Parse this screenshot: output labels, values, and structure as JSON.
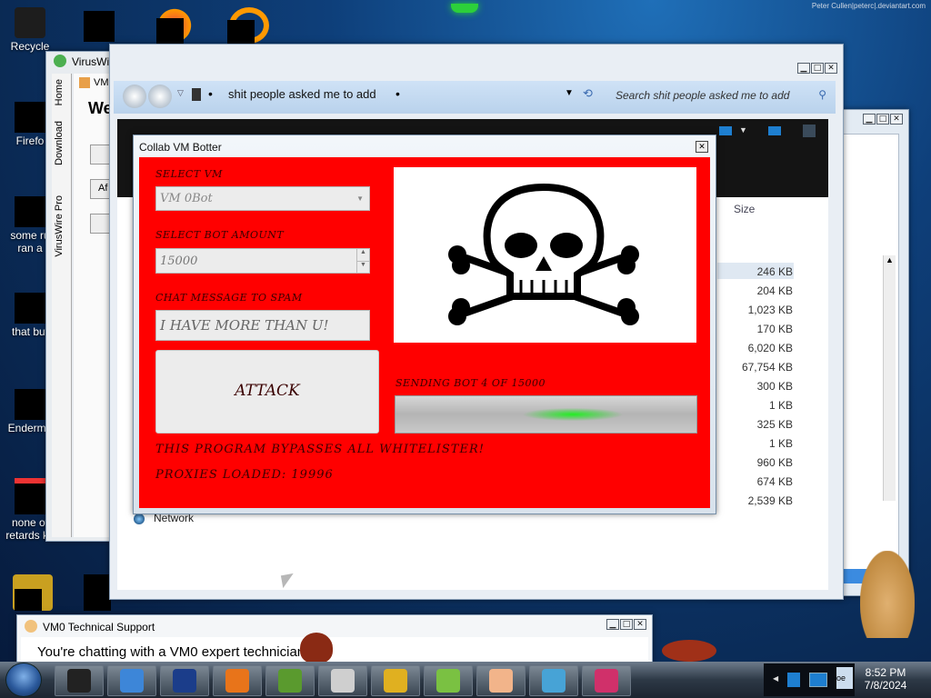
{
  "watermark": "Peter Cullen|peterc|.deviantart.com",
  "desktop_icons": [
    {
      "label": "Recycle"
    },
    {
      "label": "Firefo"
    },
    {
      "label": "some ru"
    },
    {
      "label": "ran a"
    },
    {
      "label": "that but"
    },
    {
      "label": "Enderma"
    },
    {
      "label": "none of"
    },
    {
      "label": "retards kn"
    }
  ],
  "viruswire": {
    "title": "VirusWi",
    "side_tabs": [
      "Home",
      "Download",
      "VirusWire Pro"
    ],
    "sub_title": "VM",
    "welcome": "We",
    "buttons": [
      "",
      "Af",
      ""
    ]
  },
  "explorer": {
    "breadcrumb": "shit people asked me to add",
    "search_placeholder": "Search shit people asked me to add",
    "column_size": "Size",
    "network_label": "Network",
    "sizes": [
      "246 KB",
      "204 KB",
      "1,023 KB",
      "170 KB",
      "6,020 KB",
      "67,754 KB",
      "300 KB",
      "1 KB",
      "325 KB",
      "1 KB",
      "960 KB",
      "674 KB",
      "2,539 KB"
    ]
  },
  "collab": {
    "title": "Collab VM Botter",
    "close_glyph": "✕",
    "select_vm_label": "SELECT VM",
    "select_vm_value": "VM 0Bot",
    "bot_amount_label": "SELECT BOT AMOUNT",
    "bot_amount_value": "15000",
    "chat_label": "CHAT MESSAGE TO SPAM",
    "chat_value": "I HAVE MORE THAN U!",
    "attack_label": "ATTACK",
    "sending_status": "SENDING BOT 4 OF 15000",
    "progress": 0.0003,
    "bypass_text": "THIS PROGRAM BYPASSES ALL WHITELISTER!",
    "proxies_text": "PROXIES LOADED: 19996"
  },
  "support": {
    "title": "VM0 Technical Support",
    "message": "You're chatting with a VM0 expert technician."
  },
  "taskbar": {
    "time": "8:52 PM",
    "date": "7/8/2024",
    "task_colors": [
      "#222222",
      "#3d86d8",
      "#1b3d8a",
      "#e8741a",
      "#5a9a2e",
      "#cfcfcf",
      "#e0b020",
      "#7ac142",
      "#f2b48a",
      "#47a3d6",
      "#d0306a"
    ],
    "tray_label": "oe"
  },
  "colors": {
    "accent_red": "#ff0000",
    "progress_green": "#22dd22"
  }
}
